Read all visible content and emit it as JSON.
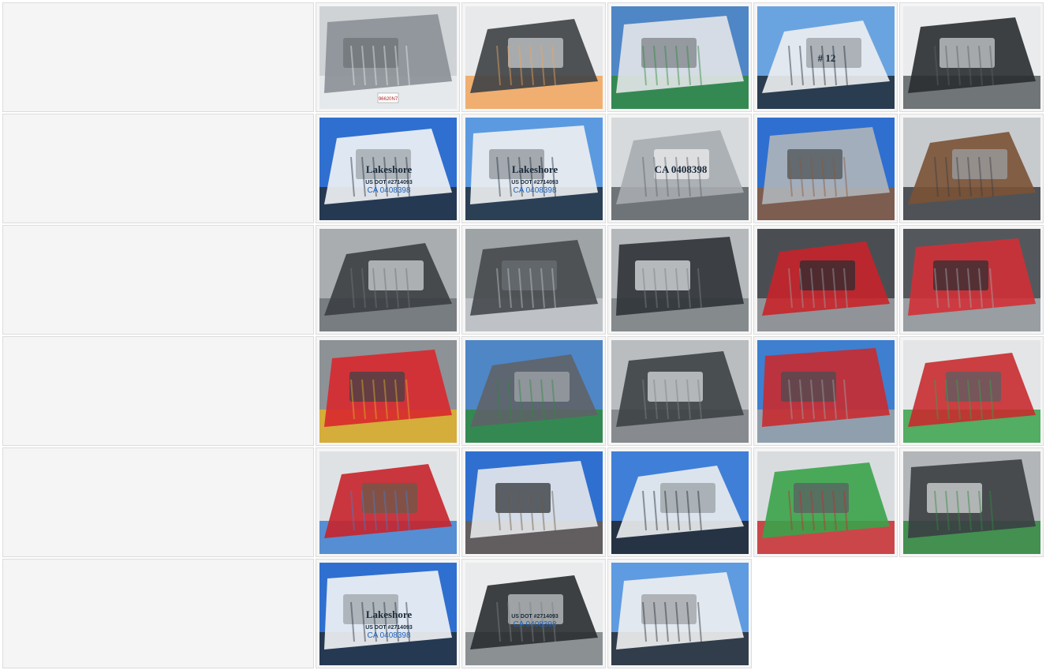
{
  "gallery": {
    "rows": [
      {
        "thumbs": [
          {
            "subject": "truck-front-grille",
            "palette": [
              "#cfd3d6",
              "#8a9096",
              "#e9ecef",
              "#6d7377"
            ],
            "caption": "",
            "plate": "96620N7"
          },
          {
            "subject": "headlight",
            "palette": [
              "#e8e9ea",
              "#3d4145",
              "#f1a55a",
              "#c6c9cc"
            ],
            "caption": ""
          },
          {
            "subject": "mirror-side",
            "palette": [
              "#4f86c6",
              "#e3e6e8",
              "#2f8a3d",
              "#7d8488"
            ],
            "caption": ""
          },
          {
            "subject": "hood-side",
            "palette": [
              "#6aa4e0",
              "#eef0f1",
              "#1f2a36",
              "#9aa0a4"
            ],
            "caption": "# 12"
          },
          {
            "subject": "front-wheel",
            "palette": [
              "#e9ebec",
              "#2a2d30",
              "#5b6064",
              "#c9cccf"
            ],
            "caption": ""
          }
        ]
      },
      {
        "thumbs": [
          {
            "subject": "cab-door-lakeshore",
            "palette": [
              "#2f6fd0",
              "#f3f4f5",
              "#24303c",
              "#9ea5aa"
            ],
            "caption": "Lakeshore",
            "dot": "US DOT #2714093",
            "ca": "CA 0408398"
          },
          {
            "subject": "cab-door-lakeshore-2",
            "palette": [
              "#5b9ae0",
              "#eff1f2",
              "#24303c",
              "#8d949a"
            ],
            "caption": "Lakeshore",
            "dot": "US DOT #2714093",
            "ca": "CA 0408398"
          },
          {
            "subject": "fuel-tank",
            "palette": [
              "#d7dadc",
              "#a7acb0",
              "#5d6266",
              "#eceeef"
            ],
            "caption": "CA 0408398"
          },
          {
            "subject": "exhaust-stack",
            "palette": [
              "#2f6fd0",
              "#b0b5b9",
              "#8a5a3a",
              "#4e5357"
            ],
            "caption": ""
          },
          {
            "subject": "exhaust-pipe",
            "palette": [
              "#c7cbce",
              "#7a5236",
              "#3a3e42",
              "#9ba0a4"
            ],
            "caption": ""
          }
        ]
      },
      {
        "thumbs": [
          {
            "subject": "fifth-wheel",
            "palette": [
              "#a9adb0",
              "#3b3f43",
              "#6f7478",
              "#d0d3d5"
            ],
            "caption": ""
          },
          {
            "subject": "fifth-wheel-2",
            "palette": [
              "#9ea3a6",
              "#45494d",
              "#c3c7ca",
              "#6a6f73"
            ],
            "caption": ""
          },
          {
            "subject": "fifth-wheel-top",
            "palette": [
              "#b5b9bc",
              "#2f3337",
              "#7c8185",
              "#dfe2e4"
            ],
            "caption": ""
          },
          {
            "subject": "rear-lights",
            "palette": [
              "#4a4e52",
              "#c8242a",
              "#9ca1a5",
              "#2b2e31"
            ],
            "caption": ""
          },
          {
            "subject": "rear-frame",
            "palette": [
              "#54585c",
              "#d23036",
              "#a5aaae",
              "#2d3033"
            ],
            "caption": ""
          }
        ]
      },
      {
        "thumbs": [
          {
            "subject": "mud-flap",
            "palette": [
              "#8d9296",
              "#d8282e",
              "#e0b22a",
              "#3f4347"
            ],
            "caption": ""
          },
          {
            "subject": "fifth-wheel-yard",
            "palette": [
              "#4f86c6",
              "#5e6367",
              "#2f8a3d",
              "#a0a5a9"
            ],
            "caption": ""
          },
          {
            "subject": "frame-deck",
            "palette": [
              "#b9bdc0",
              "#3d4145",
              "#7e8387",
              "#d8dbdd"
            ],
            "caption": ""
          },
          {
            "subject": "air-lines-deck",
            "palette": [
              "#3e7fd0",
              "#c82b2f",
              "#9fa4a8",
              "#4a4e52"
            ],
            "caption": ""
          },
          {
            "subject": "air-lines-cab",
            "palette": [
              "#e3e5e7",
              "#c82b2f",
              "#39a34a",
              "#5a5f63"
            ],
            "caption": ""
          }
        ]
      },
      {
        "thumbs": [
          {
            "subject": "cab-back-lines",
            "palette": [
              "#dfe2e4",
              "#c8242a",
              "#3e7fd0",
              "#6b5a4a"
            ],
            "caption": ""
          },
          {
            "subject": "cab-back-window",
            "palette": [
              "#2f6fd0",
              "#e6e8ea",
              "#6b5a4a",
              "#31363a"
            ],
            "caption": ""
          },
          {
            "subject": "cab-rear-sleeper",
            "palette": [
              "#3f7fd8",
              "#eceeef",
              "#22262a",
              "#9aa0a4"
            ],
            "caption": ""
          },
          {
            "subject": "cab-rear-green-line",
            "palette": [
              "#d9dcde",
              "#39a34a",
              "#c82b2f",
              "#5a5f63"
            ],
            "caption": ""
          },
          {
            "subject": "steps-tank",
            "palette": [
              "#b2b6b9",
              "#3b3f43",
              "#2f8a3d",
              "#d5d8da"
            ],
            "caption": ""
          }
        ]
      },
      {
        "thumbs": [
          {
            "subject": "cab-door-lakeshore-3",
            "palette": [
              "#2f6fd0",
              "#f3f4f5",
              "#24303c",
              "#9ea5aa"
            ],
            "caption": "Lakeshore",
            "dot": "US DOT #2714093",
            "ca": "CA 0408398"
          },
          {
            "subject": "side-tank-dot",
            "palette": [
              "#e9ebec",
              "#2a2d30",
              "#7a8084",
              "#c0c4c7"
            ],
            "caption": "",
            "dot": "US DOT #2714093",
            "ca": "CA 0408398"
          },
          {
            "subject": "hood-front-quarter",
            "palette": [
              "#5f9be0",
              "#eff1f2",
              "#2a2d30",
              "#9da2a6"
            ],
            "caption": ""
          }
        ]
      }
    ]
  }
}
